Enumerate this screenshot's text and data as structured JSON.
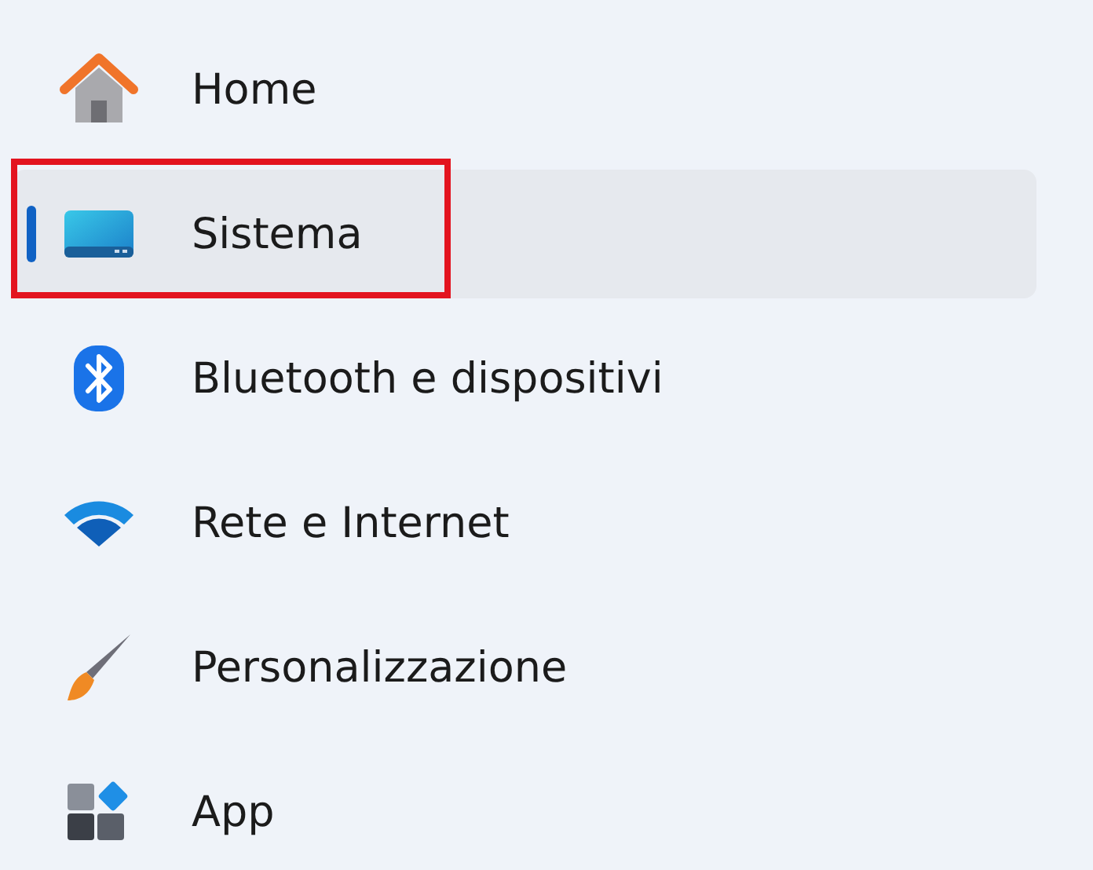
{
  "sidebar": {
    "items": [
      {
        "kind": "home",
        "label": "Home",
        "selected": false,
        "annotated": false
      },
      {
        "kind": "system",
        "label": "Sistema",
        "selected": true,
        "annotated": true
      },
      {
        "kind": "bluetooth",
        "label": "Bluetooth e dispositivi",
        "selected": false,
        "annotated": false
      },
      {
        "kind": "network",
        "label": "Rete e Internet",
        "selected": false,
        "annotated": false
      },
      {
        "kind": "personalization",
        "label": "Personalizzazione",
        "selected": false,
        "annotated": false
      },
      {
        "kind": "apps",
        "label": "App",
        "selected": false,
        "annotated": false
      }
    ]
  }
}
